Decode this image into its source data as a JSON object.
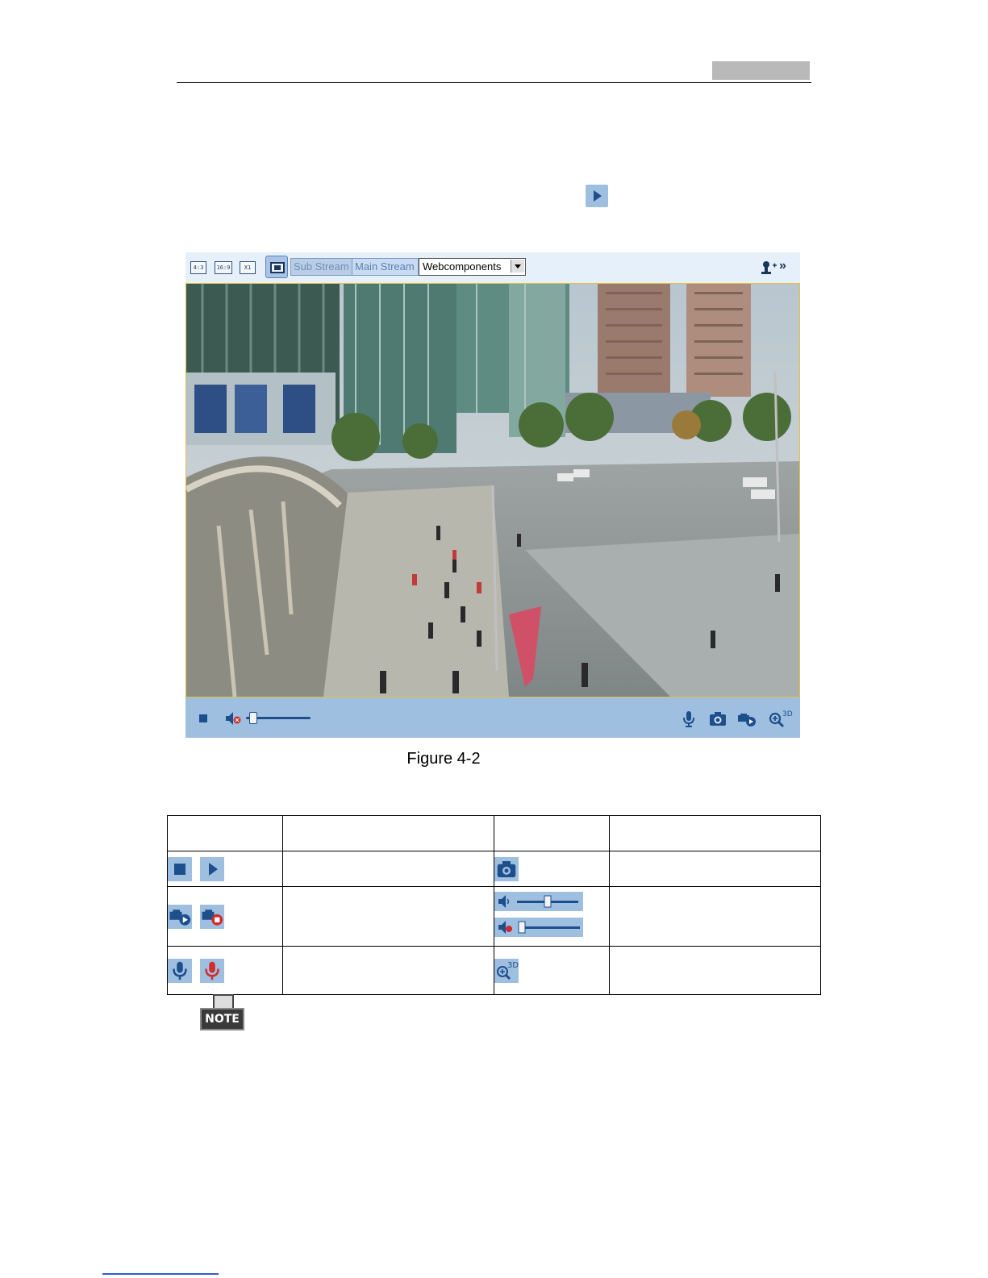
{
  "viewer": {
    "toolbar": {
      "ratio_buttons": [
        "4:3",
        "16:9",
        "X1"
      ],
      "sub_stream": "Sub Stream",
      "main_stream": "Main Stream",
      "plugin_select": "Webcomponents",
      "expand": "»"
    },
    "bottom_bar": {
      "volume_level": 0.05
    }
  },
  "caption": "Figure 4-2",
  "table": {
    "zoom_label": "3D"
  },
  "note": {
    "label": "NOTE"
  },
  "colors": {
    "accent": "#9fbfe0",
    "icon": "#1d4f8c",
    "record": "#d42a2a"
  }
}
